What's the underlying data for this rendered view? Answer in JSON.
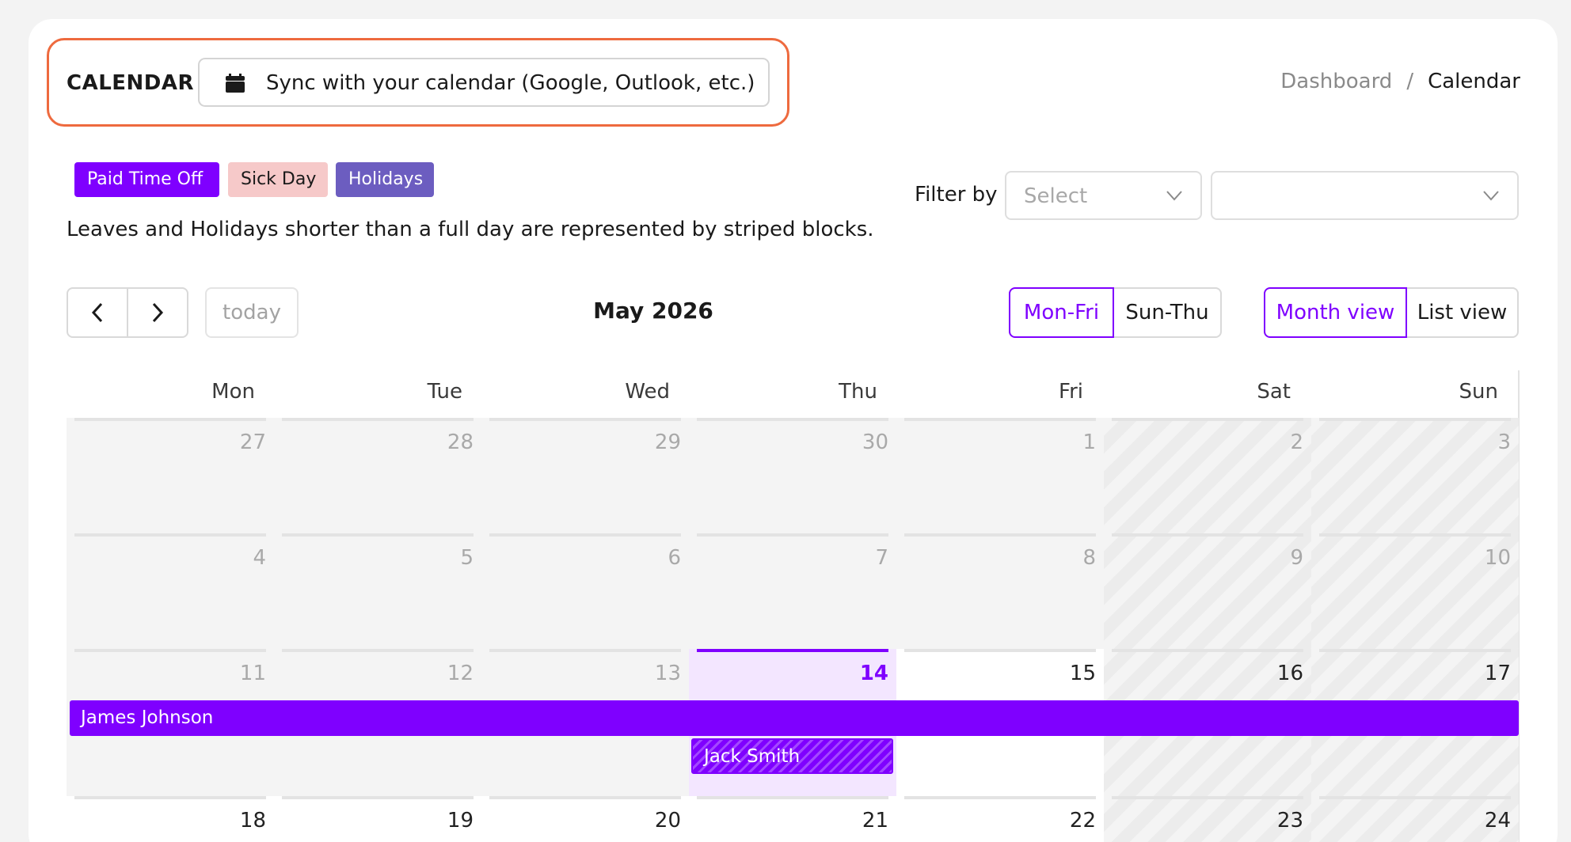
{
  "header": {
    "title": "CALENDAR",
    "sync_label": "Sync with your calendar (Google, Outlook, etc.)",
    "sync_icon": "calendar-icon",
    "highlight_color": "#ee6a3e"
  },
  "breadcrumb": {
    "items": [
      "Dashboard",
      "Calendar"
    ],
    "separator": "/"
  },
  "legend": {
    "items": [
      {
        "label": "Paid Time Off",
        "color": "#7f00ff"
      },
      {
        "label": "Sick Day",
        "color": "#f6c9c9"
      },
      {
        "label": "Holidays",
        "color": "#6c5dc0"
      }
    ],
    "note": "Leaves and Holidays shorter than a full day are represented by striped blocks."
  },
  "filter": {
    "label": "Filter by",
    "select1_placeholder": "Select",
    "select2_value": ""
  },
  "toolbar": {
    "prev_icon": "chevron-left-icon",
    "next_icon": "chevron-right-icon",
    "today_label": "today",
    "month_title": "May 2026",
    "week_options": [
      "Mon-Fri",
      "Sun-Thu"
    ],
    "week_selected": "Mon-Fri",
    "view_options": [
      "Month view",
      "List view"
    ],
    "view_selected": "Month view",
    "accent_color": "#7f00ff"
  },
  "calendar": {
    "days_of_week": [
      "Mon",
      "Tue",
      "Wed",
      "Thu",
      "Fri",
      "Sat",
      "Sun"
    ],
    "weeks": [
      [
        "27",
        "28",
        "29",
        "30",
        "1",
        "2",
        "3"
      ],
      [
        "4",
        "5",
        "6",
        "7",
        "8",
        "9",
        "10"
      ],
      [
        "11",
        "12",
        "13",
        "14",
        "15",
        "16",
        "17"
      ],
      [
        "18",
        "19",
        "20",
        "21",
        "22",
        "23",
        "24"
      ]
    ],
    "today": "14"
  },
  "events": [
    {
      "name": "James Johnson",
      "type": "Paid Time Off",
      "full_day": true
    },
    {
      "name": "Jack Smith",
      "type": "Paid Time Off",
      "full_day": false
    }
  ]
}
